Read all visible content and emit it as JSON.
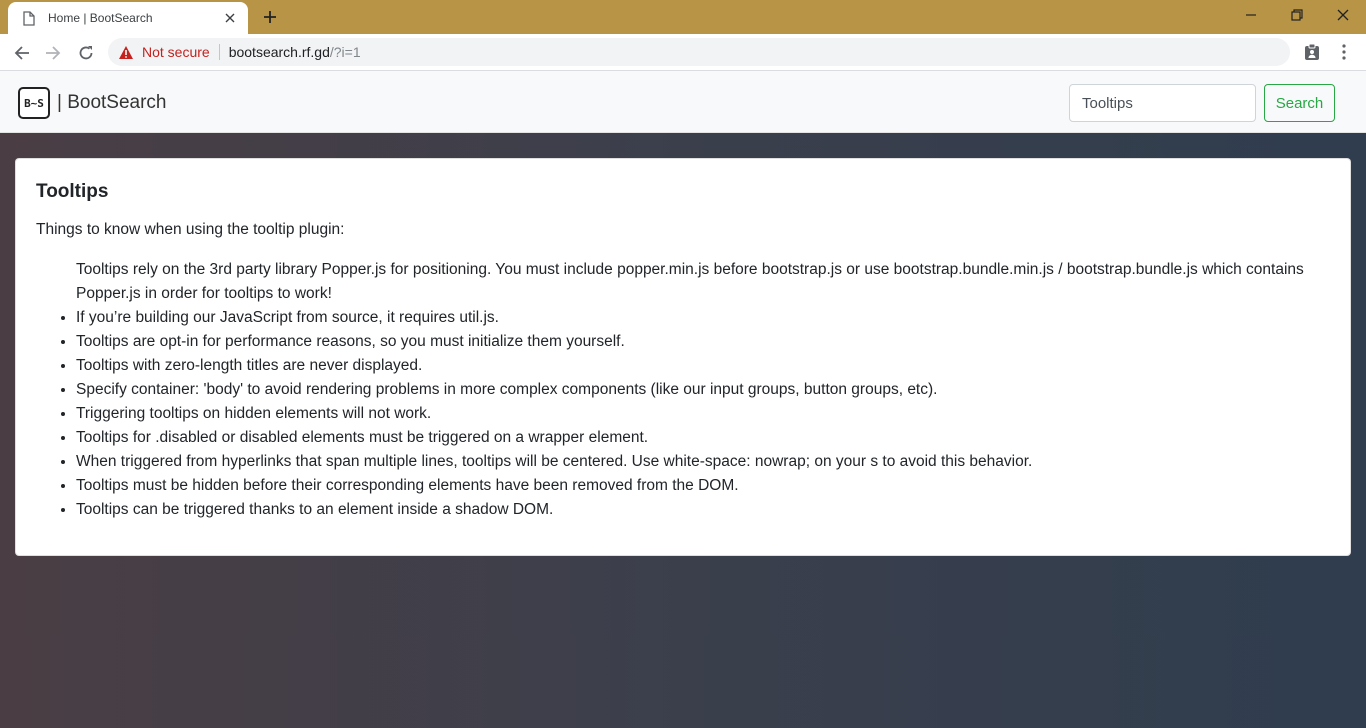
{
  "browser": {
    "tab_title": "Home | BootSearch",
    "security_label": "Not secure",
    "url_host": "bootsearch.rf.gd",
    "url_path": "/?i=1",
    "icons": {
      "tab": "page-icon",
      "close": "close-icon",
      "new_tab": "plus-icon",
      "back": "back-arrow-icon",
      "forward": "forward-arrow-icon",
      "reload": "reload-icon",
      "warning": "warning-icon",
      "extension": "clipboard-icon",
      "menu": "kebab-menu-icon"
    }
  },
  "navbar": {
    "brand_logo": "B~S",
    "brand_text": "| BootSearch",
    "search_value": "Tooltips",
    "search_button": "Search"
  },
  "card": {
    "title": "Tooltips",
    "intro": "Things to know when using the tooltip plugin:",
    "lead_item": "Tooltips rely on the 3rd party library Popper.js for positioning. You must include popper.min.js before bootstrap.js or use bootstrap.bundle.min.js / bootstrap.bundle.js which contains Popper.js in order for tooltips to work!",
    "items": [
      "If you’re building our JavaScript from source, it requires util.js.",
      "Tooltips are opt-in for performance reasons, so you must initialize them yourself.",
      "Tooltips with zero-length titles are never displayed.",
      "Specify container: 'body' to avoid rendering problems in more complex components (like our input groups, button groups, etc).",
      "Triggering tooltips on hidden elements will not work.",
      "Tooltips for .disabled or disabled elements must be triggered on a wrapper element.",
      "When triggered from hyperlinks that span multiple lines, tooltips will be centered. Use white-space: nowrap; on your s to avoid this behavior.",
      "Tooltips must be hidden before their corresponding elements have been removed from the DOM.",
      "Tooltips can be triggered thanks to an element inside a shadow DOM."
    ]
  },
  "colors": {
    "tabstrip": "#b79446",
    "accent_success": "#28a745",
    "warning": "#c5221f"
  }
}
